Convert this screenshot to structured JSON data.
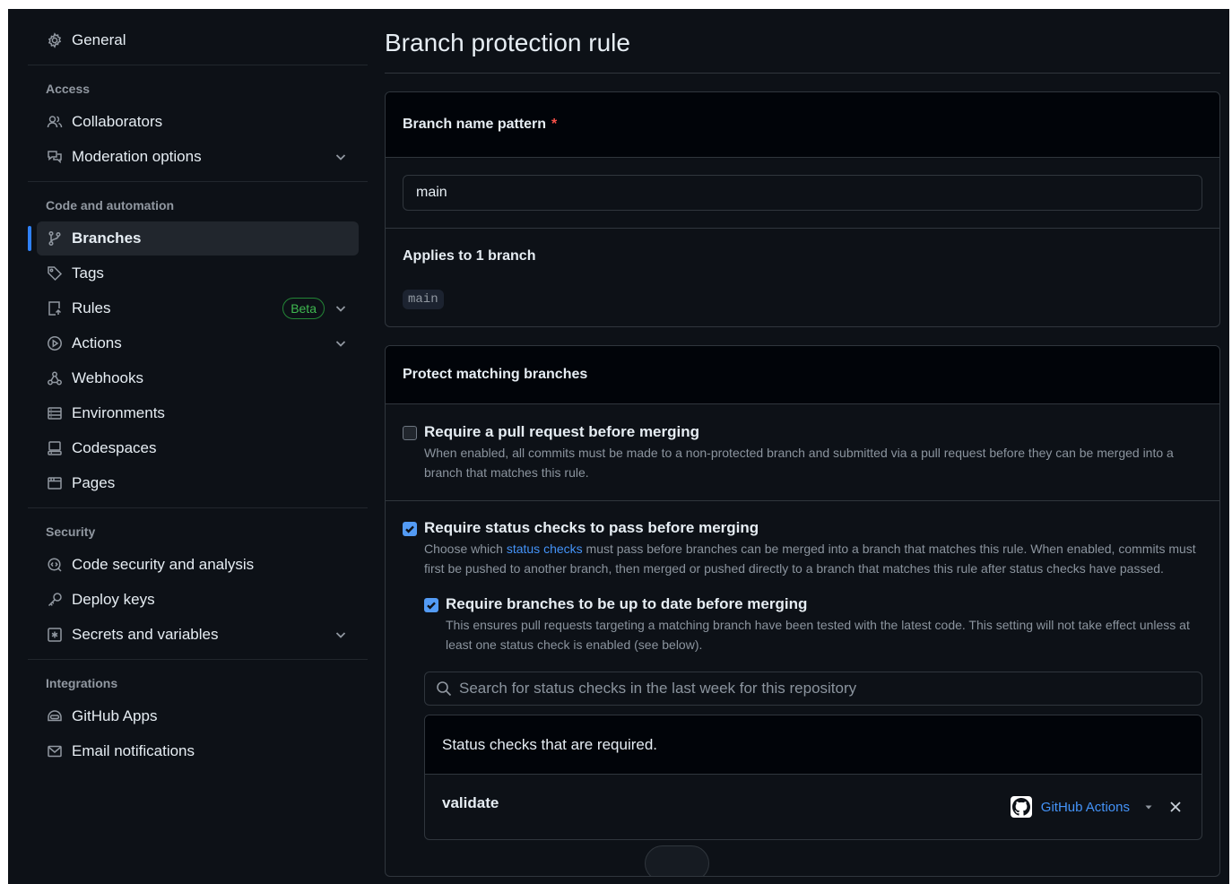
{
  "sidebar": {
    "general": "General",
    "sections": {
      "access": "Access",
      "code": "Code and automation",
      "security": "Security",
      "integrations": "Integrations"
    },
    "access_items": [
      "Collaborators",
      "Moderation options"
    ],
    "code_items": [
      "Branches",
      "Tags",
      "Rules",
      "Actions",
      "Webhooks",
      "Environments",
      "Codespaces",
      "Pages"
    ],
    "rules_badge": "Beta",
    "security_items": [
      "Code security and analysis",
      "Deploy keys",
      "Secrets and variables"
    ],
    "integration_items": [
      "GitHub Apps",
      "Email notifications"
    ],
    "active": "Branches"
  },
  "main": {
    "title": "Branch protection rule",
    "pattern": {
      "label": "Branch name pattern",
      "required_mark": "*",
      "value": "main",
      "applies_label": "Applies to 1 branch",
      "branch": "main"
    },
    "protect": {
      "heading": "Protect matching branches",
      "pr": {
        "checked": false,
        "title": "Require a pull request before merging",
        "desc": "When enabled, all commits must be made to a non-protected branch and submitted via a pull request before they can be merged into a branch that matches this rule."
      },
      "status": {
        "checked": true,
        "title": "Require status checks to pass before merging",
        "desc_pre": "Choose which ",
        "desc_link": "status checks",
        "desc_post": " must pass before branches can be merged into a branch that matches this rule. When enabled, commits must first be pushed to another branch, then merged or pushed directly to a branch that matches this rule after status checks have passed."
      },
      "uptodate": {
        "checked": true,
        "title": "Require branches to be up to date before merging",
        "desc": "This ensures pull requests targeting a matching branch have been tested with the latest code. This setting will not take effect unless at least one status check is enabled (see below)."
      },
      "search_placeholder": "Search for status checks in the last week for this repository",
      "required_heading": "Status checks that are required.",
      "checks": [
        {
          "name": "validate",
          "source": "GitHub Actions"
        }
      ]
    }
  },
  "colors": {
    "bg": "#0d1117",
    "accent": "#2f81f7",
    "link": "#4493f8",
    "beta": "#3fb950"
  }
}
